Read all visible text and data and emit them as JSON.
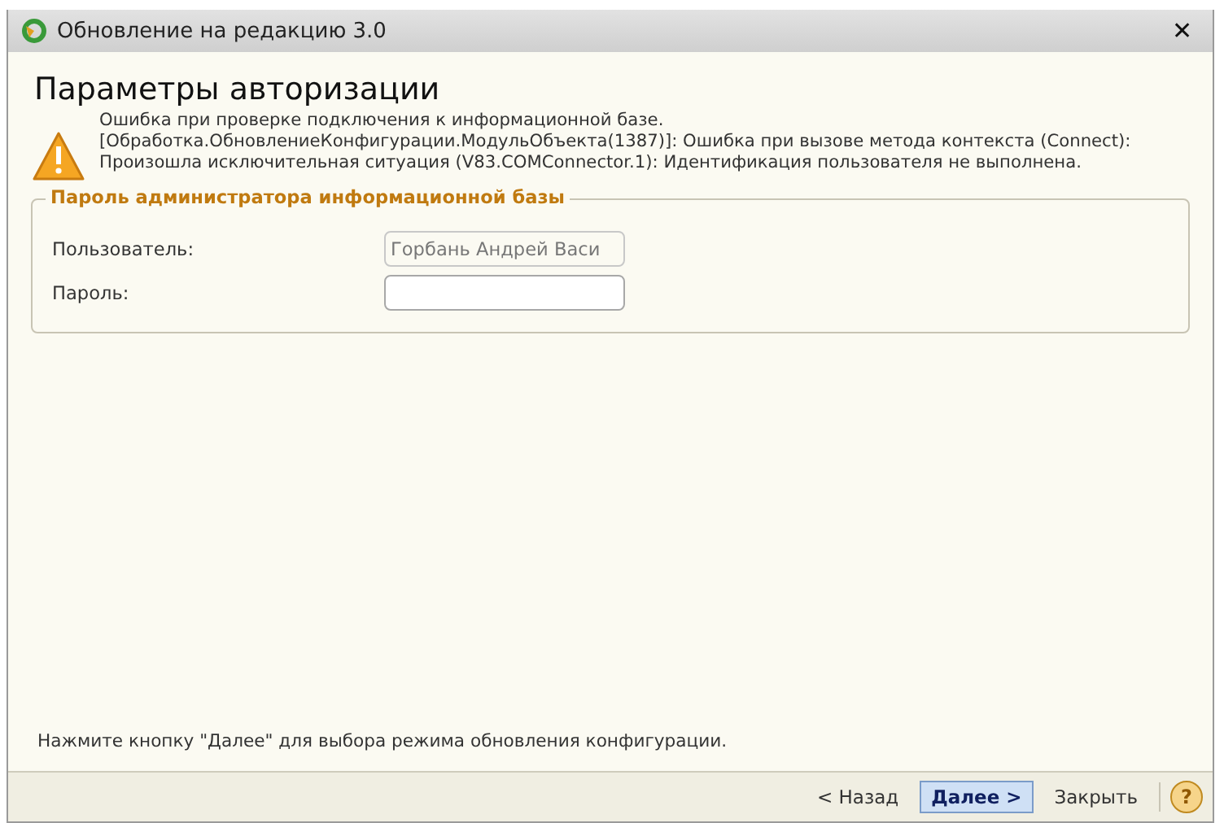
{
  "window": {
    "title": "Обновление на редакцию 3.0",
    "close": "✕"
  },
  "heading": "Параметры авторизации",
  "error": {
    "lines": [
      "Ошибка при проверке подключения к информационной базе.",
      "[Обработка.ОбновлениеКонфигурации.МодульОбъекта(1387)]: Ошибка при вызове метода контекста (Connect): Произошла исключительная ситуация (V83.COMConnector.1): Идентификация пользователя не выполнена."
    ]
  },
  "group": {
    "title": "Пароль администратора информационной базы",
    "fields": [
      {
        "label": "Пользователь:",
        "value": "Горбань Андрей Васи",
        "disabled": true
      },
      {
        "label": "Пароль:",
        "disabled": false
      }
    ]
  },
  "hint": "Нажмите кнопку \"Далее\" для выбора режима обновления конфигурации.",
  "buttons": [
    {
      "label": "< Назад",
      "default": false
    },
    {
      "label": "Далее >",
      "default": true
    },
    {
      "label": "Закрыть",
      "default": false
    }
  ],
  "help": "?"
}
